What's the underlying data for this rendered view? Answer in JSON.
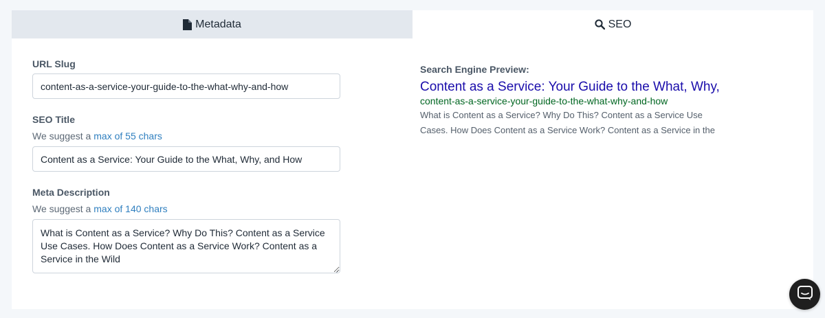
{
  "tabs": {
    "metadata": {
      "label": "Metadata",
      "icon": "file-icon"
    },
    "seo": {
      "label": "SEO",
      "icon": "search-icon"
    }
  },
  "form": {
    "url_slug": {
      "label": "URL Slug",
      "value": "content-as-a-service-your-guide-to-the-what-why-and-how"
    },
    "seo_title": {
      "label": "SEO Title",
      "hint_prefix": "We suggest a ",
      "hint_link": "max of 55 chars",
      "value": "Content as a Service: Your Guide to the What, Why, and How"
    },
    "meta_description": {
      "label": "Meta Description",
      "hint_prefix": "We suggest a ",
      "hint_link": "max of 140 chars",
      "value": "What is Content as a Service? Why Do This?  Content as a Service Use Cases. How Does Content as a Service Work? Content as a Service in the Wild"
    }
  },
  "preview": {
    "label": "Search Engine Preview:",
    "title": "Content as a Service: Your Guide to the What, Why, and",
    "url": "content-as-a-service-your-guide-to-the-what-why-and-how",
    "description": "What is Content as a Service? Why Do This? Content as a Service Use Cases. How Does Content as a Service Work? Content as a Service in the"
  },
  "colors": {
    "active_tab_bg": "#e3e8ee",
    "link": "#2f7fbf",
    "preview_title": "#1a0dab",
    "preview_url": "#006621"
  },
  "chat_button": {
    "icon": "chat-icon"
  }
}
